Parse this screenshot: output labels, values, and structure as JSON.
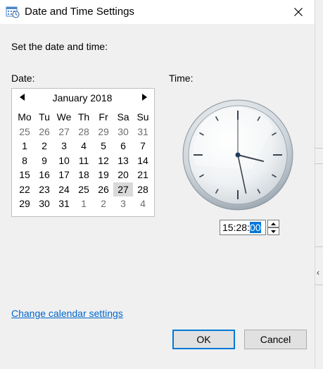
{
  "window": {
    "title": "Date and Time Settings"
  },
  "prompt": "Set the date and time:",
  "date_label": "Date:",
  "time_label": "Time:",
  "calendar": {
    "month_label": "January 2018",
    "prev_icon": "triangle-left-icon",
    "next_icon": "triangle-right-icon",
    "weekdays": [
      "Mo",
      "Tu",
      "We",
      "Th",
      "Fr",
      "Sa",
      "Su"
    ],
    "days": [
      {
        "d": "25",
        "dim": true
      },
      {
        "d": "26",
        "dim": true
      },
      {
        "d": "27",
        "dim": true
      },
      {
        "d": "28",
        "dim": true
      },
      {
        "d": "29",
        "dim": true
      },
      {
        "d": "30",
        "dim": true
      },
      {
        "d": "31",
        "dim": true
      },
      {
        "d": "1"
      },
      {
        "d": "2"
      },
      {
        "d": "3"
      },
      {
        "d": "4"
      },
      {
        "d": "5"
      },
      {
        "d": "6"
      },
      {
        "d": "7"
      },
      {
        "d": "8"
      },
      {
        "d": "9"
      },
      {
        "d": "10"
      },
      {
        "d": "11"
      },
      {
        "d": "12"
      },
      {
        "d": "13"
      },
      {
        "d": "14"
      },
      {
        "d": "15"
      },
      {
        "d": "16"
      },
      {
        "d": "17"
      },
      {
        "d": "18"
      },
      {
        "d": "19"
      },
      {
        "d": "20"
      },
      {
        "d": "21"
      },
      {
        "d": "22"
      },
      {
        "d": "23"
      },
      {
        "d": "24"
      },
      {
        "d": "25"
      },
      {
        "d": "26"
      },
      {
        "d": "27",
        "today": true
      },
      {
        "d": "28"
      },
      {
        "d": "29"
      },
      {
        "d": "30"
      },
      {
        "d": "31"
      },
      {
        "d": "1",
        "dim": true
      },
      {
        "d": "2",
        "dim": true
      },
      {
        "d": "3",
        "dim": true
      },
      {
        "d": "4",
        "dim": true
      }
    ]
  },
  "clock": {
    "hour": 15,
    "minute": 28,
    "second": 0
  },
  "time_field": {
    "hours": "15",
    "sep1": ":",
    "minutes": "28",
    "sep2": ":",
    "seconds": "00"
  },
  "link_text": "Change calendar settings",
  "buttons": {
    "ok": "OK",
    "cancel": "Cancel"
  },
  "colors": {
    "accent": "#0078d7",
    "link": "#0066cc",
    "today_bg": "#d9d9d9"
  }
}
